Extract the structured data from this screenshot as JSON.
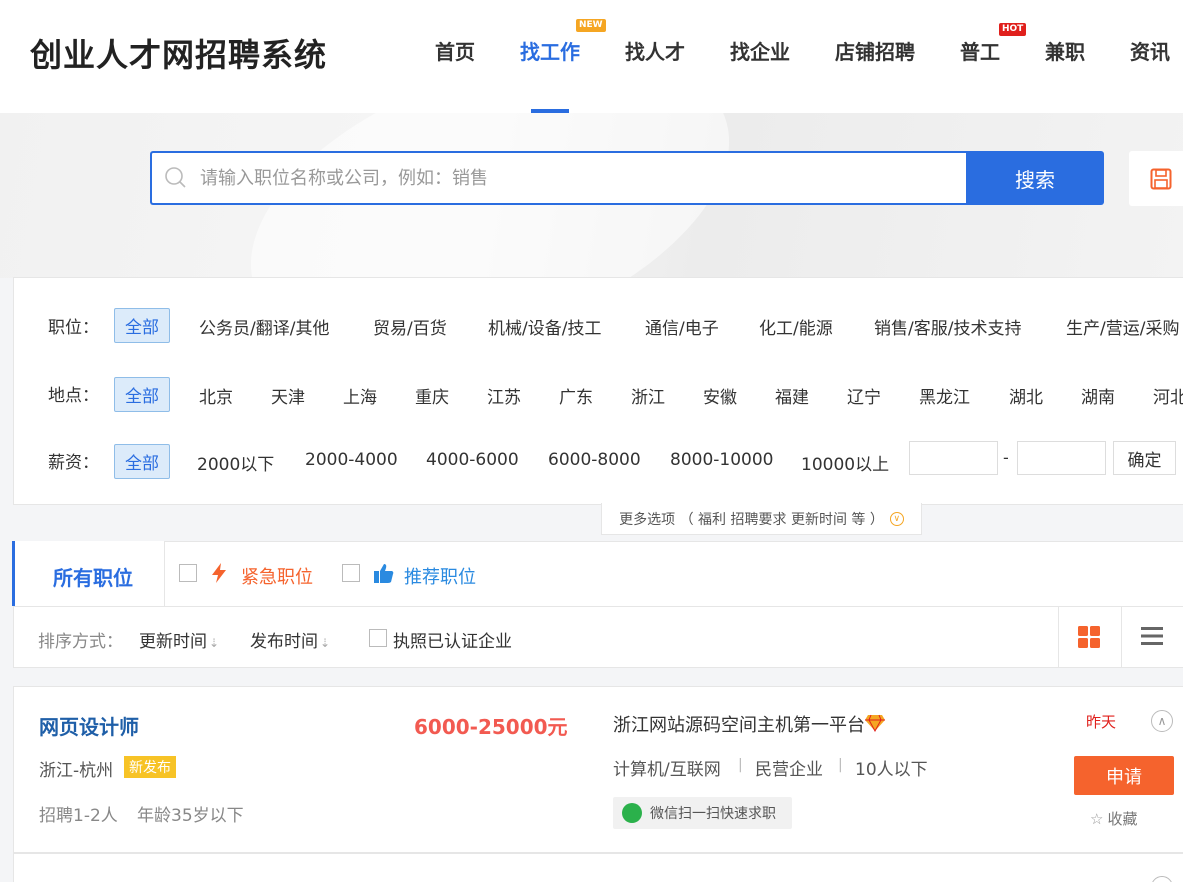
{
  "site": {
    "logo_text": "创业人才网招聘系统"
  },
  "nav": {
    "items": [
      "首页",
      "找工作",
      "找人才",
      "找企业",
      "店铺招聘",
      "普工",
      "兼职",
      "资讯"
    ],
    "active_index": 1,
    "badge_new": "NEW",
    "badge_hot": "HOT"
  },
  "search": {
    "placeholder": "请输入职位名称或公司，例如：销售",
    "button_label": "搜索"
  },
  "filters": {
    "position_label": "职位：",
    "position_options": [
      "全部",
      "公务员/翻译/其他",
      "贸易/百货",
      "机械/设备/技工",
      "通信/电子",
      "化工/能源",
      "销售/客服/技术支持",
      "生产/营运/采购"
    ],
    "location_label": "地点：",
    "location_options": [
      "全部",
      "北京",
      "天津",
      "上海",
      "重庆",
      "江苏",
      "广东",
      "浙江",
      "安徽",
      "福建",
      "辽宁",
      "黑龙江",
      "湖北",
      "湖南",
      "河北"
    ],
    "salary_label": "薪资：",
    "salary_options": [
      "全部",
      "2000以下",
      "2000-4000",
      "4000-6000",
      "6000-8000",
      "8000-10000",
      "10000以上"
    ],
    "salary_range_dash": "-",
    "confirm_label": "确定",
    "more_options": "更多选项 （ 福利 招聘要求 更新时间 等 ）"
  },
  "tabs": {
    "all_label": "所有职位",
    "urgent_label": "紧急职位",
    "recommended_label": "推荐职位"
  },
  "sort": {
    "label": "排序方式：",
    "by_update": "更新时间",
    "by_publish": "发布时间",
    "arrow": "⇣",
    "verified_label": "执照已认证企业"
  },
  "colors": {
    "accent": "#2a6de0",
    "salary": "#f25a51",
    "apply": "#f5632d",
    "new_tag": "#f7c326",
    "grid_icon": "#f5632d"
  },
  "jobs": [
    {
      "title": "网页设计师",
      "salary": "6000-25000元",
      "location": "浙江-杭州",
      "tag": "新发布",
      "headcount": "招聘1-2人",
      "age": "年龄35岁以下",
      "company": "浙江网站源码空间主机第一平台",
      "industry": "计算机/互联网",
      "company_type": "民营企业",
      "company_size": "10人以下",
      "separator": "|",
      "wechat": "微信扫一扫快速求职",
      "date": "昨天",
      "apply_label": "申请",
      "favorite_label": "收藏"
    }
  ]
}
